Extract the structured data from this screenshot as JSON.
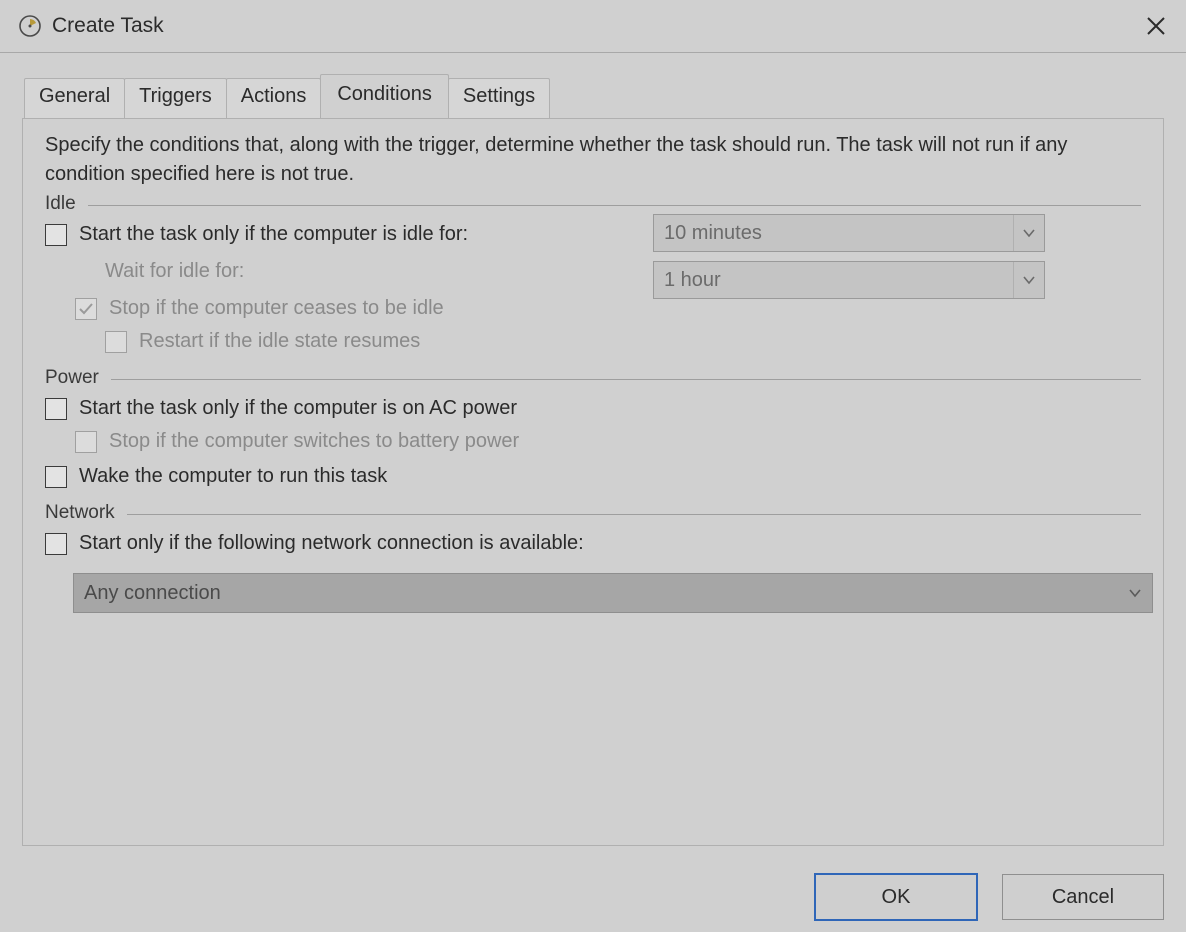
{
  "window": {
    "title": "Create Task"
  },
  "tabs": {
    "general": "General",
    "triggers": "Triggers",
    "actions": "Actions",
    "conditions": "Conditions",
    "settings": "Settings",
    "active": "conditions"
  },
  "conditions": {
    "description": "Specify the conditions that, along with the trigger, determine whether the task should run.  The task will not run  if any condition specified here is not true.",
    "idle": {
      "section_label": "Idle",
      "start_only_if_idle_label": "Start the task only if the computer is idle for:",
      "start_only_if_idle_checked": false,
      "idle_duration_value": "10 minutes",
      "wait_for_idle_label": "Wait for idle for:",
      "wait_for_idle_value": "1 hour",
      "stop_if_ceases_label": "Stop if the computer ceases to be idle",
      "stop_if_ceases_checked": true,
      "restart_if_resumes_label": "Restart if the idle state resumes",
      "restart_if_resumes_checked": false
    },
    "power": {
      "section_label": "Power",
      "start_only_on_ac_label": "Start the task only if the computer is on AC power",
      "start_only_on_ac_checked": false,
      "stop_on_battery_label": "Stop if the computer switches to battery power",
      "stop_on_battery_checked": false,
      "wake_to_run_label": "Wake the computer to run this task",
      "wake_to_run_checked": false
    },
    "network": {
      "section_label": "Network",
      "start_only_if_network_label": "Start only if the following network connection is available:",
      "start_only_if_network_checked": false,
      "connection_value": "Any connection"
    }
  },
  "footer": {
    "ok": "OK",
    "cancel": "Cancel"
  }
}
